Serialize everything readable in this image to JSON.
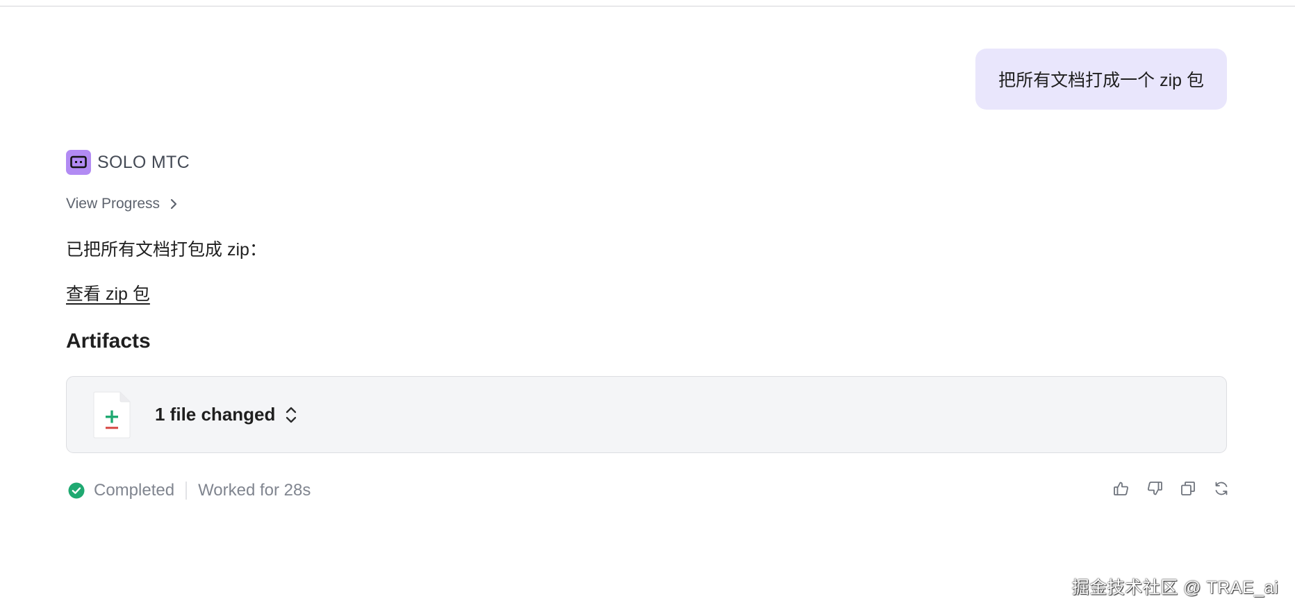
{
  "user_message": {
    "text": "把所有文档打成一个 zip 包"
  },
  "assistant": {
    "name": "SOLO MTC",
    "view_progress_label": "View Progress",
    "response_text": "已把所有文档打包成 zip：",
    "zip_link_label": "查看 zip 包",
    "artifacts_heading": "Artifacts",
    "artifact_card": {
      "label": "1 file changed"
    }
  },
  "status": {
    "completed_label": "Completed",
    "worked_label": "Worked for 28s"
  },
  "icons": {
    "agent_avatar": "robot-icon",
    "view_progress_chevron": "chevron-right-icon",
    "file": "file-diff-icon",
    "expand": "chevron-up-down-icon",
    "status": "check-circle-icon",
    "actions": [
      "thumbs-up-icon",
      "thumbs-down-icon",
      "copy-icon",
      "refresh-icon"
    ]
  },
  "colors": {
    "user_bubble": "#e9e6fc",
    "avatar": "#b28bf3",
    "success": "#1fa971",
    "diff_add": "#1fa971",
    "diff_remove": "#d9534f",
    "card_bg": "#f4f5f7"
  },
  "watermark": "掘金技术社区 @ TRAE_ai"
}
